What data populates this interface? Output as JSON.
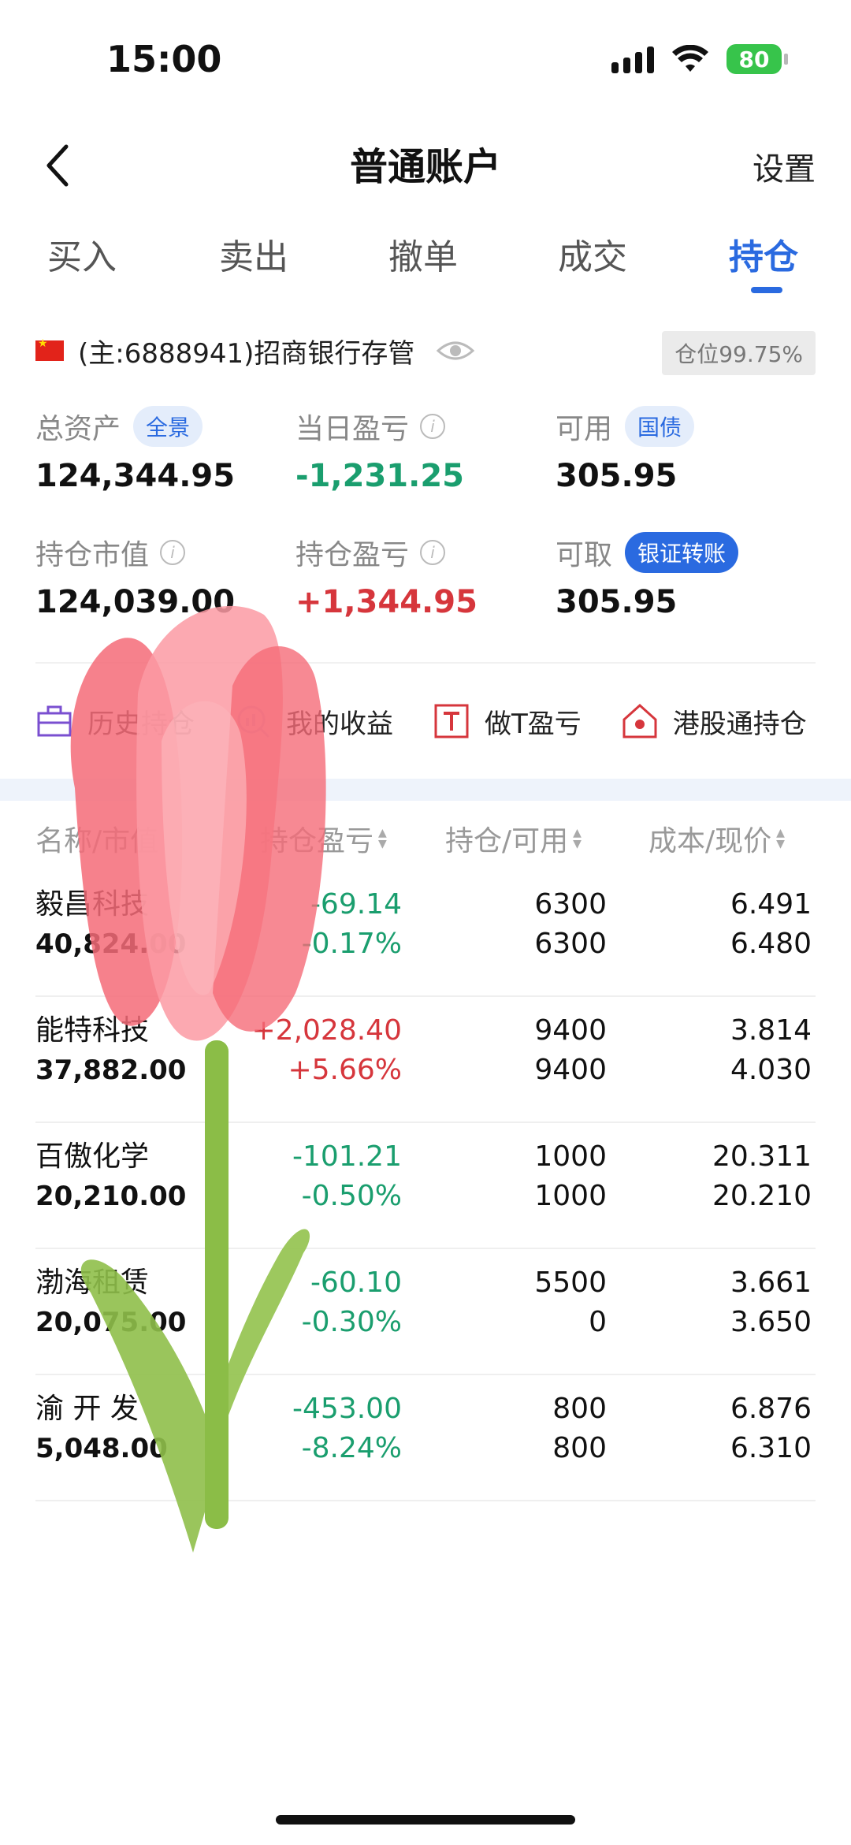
{
  "status_bar": {
    "time": "15:00",
    "battery": "80"
  },
  "nav": {
    "title": "普通账户",
    "settings": "设置"
  },
  "tabs": [
    {
      "label": "买入"
    },
    {
      "label": "卖出"
    },
    {
      "label": "撤单"
    },
    {
      "label": "成交"
    },
    {
      "label": "持仓",
      "active": true
    }
  ],
  "account": {
    "text": "(主:6888941)招商银行存管",
    "position_ratio": "仓位99.75%"
  },
  "metrics": {
    "total_assets": {
      "label": "总资产",
      "pill": "全景",
      "value": "124,344.95"
    },
    "daily_pl": {
      "label": "当日盈亏",
      "value": "-1,231.25"
    },
    "available": {
      "label": "可用",
      "pill": "国债",
      "value": "305.95"
    },
    "market_value": {
      "label": "持仓市值",
      "value": "124,039.00"
    },
    "position_pl": {
      "label": "持仓盈亏",
      "value": "+1,344.95"
    },
    "withdrawable": {
      "label": "可取",
      "pill": "银证转账",
      "value": "305.95"
    }
  },
  "shortcuts": [
    {
      "label": "历史持仓",
      "icon": "briefcase-icon"
    },
    {
      "label": "我的收益",
      "icon": "chart-magnifier-icon"
    },
    {
      "label": "做T盈亏",
      "icon": "t-box-icon"
    },
    {
      "label": "港股通持仓",
      "icon": "hk-home-icon"
    }
  ],
  "table": {
    "headers": [
      "名称/市值",
      "持仓盈亏",
      "持仓/可用",
      "成本/现价"
    ],
    "rows": [
      {
        "name": "毅昌科技",
        "market_value": "40,824.00",
        "pl": "-69.14",
        "pl_pct": "-0.17%",
        "hold": "6300",
        "avail": "6300",
        "cost": "6.491",
        "price": "6.480",
        "trend": "green"
      },
      {
        "name": "能特科技",
        "market_value": "37,882.00",
        "pl": "+2,028.40",
        "pl_pct": "+5.66%",
        "hold": "9400",
        "avail": "9400",
        "cost": "3.814",
        "price": "4.030",
        "trend": "red"
      },
      {
        "name": "百傲化学",
        "market_value": "20,210.00",
        "pl": "-101.21",
        "pl_pct": "-0.50%",
        "hold": "1000",
        "avail": "1000",
        "cost": "20.311",
        "price": "20.210",
        "trend": "green"
      },
      {
        "name": "渤海租赁",
        "market_value": "20,075.00",
        "pl": "-60.10",
        "pl_pct": "-0.30%",
        "hold": "5500",
        "avail": "0",
        "cost": "3.661",
        "price": "3.650",
        "trend": "green"
      },
      {
        "name": "渝 开 发",
        "market_value": "5,048.00",
        "pl": "-453.00",
        "pl_pct": "-8.24%",
        "hold": "800",
        "avail": "800",
        "cost": "6.876",
        "price": "6.310",
        "trend": "green"
      }
    ]
  },
  "colors": {
    "accent": "#2a6ae0",
    "gain": "#d6363c",
    "loss": "#1a9e6e"
  }
}
